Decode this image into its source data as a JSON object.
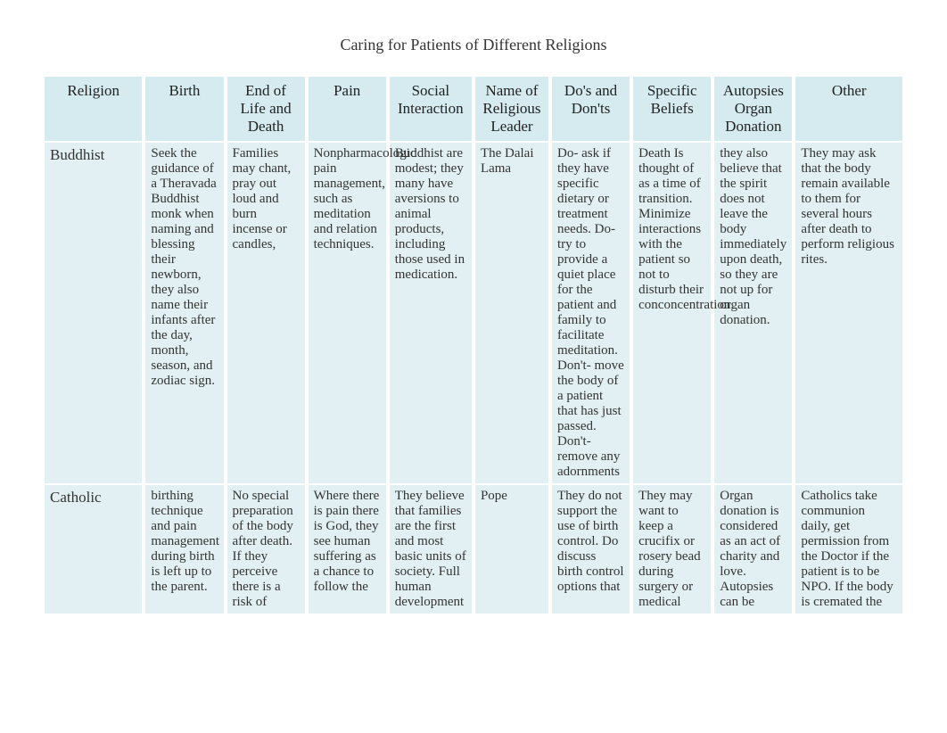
{
  "title": "Caring for Patients of Different Religions",
  "columns": [
    "Religion",
    "Birth",
    "End of Life and Death",
    "Pain",
    "Social Interaction",
    "Name of Religious Leader",
    "Do's and Don'ts",
    "Specific Beliefs",
    "Autopsies Organ Donation",
    "Other"
  ],
  "rows": [
    {
      "religion": "Buddhist",
      "birth": "Seek the guidance of a Theravada Buddhist monk when naming and blessing their newborn, they also name their infants after the day, month, season, and zodiac sign.",
      "endlife": "Families may chant, pray out loud and burn incense or candles,",
      "pain": "Nonpharmacologic pain management, such as meditation and relation techniques.",
      "social": "Buddhist are modest; they many have aversions to animal products, including those used in medication.",
      "leader": "The Dalai Lama",
      "dos": "Do- ask if they have specific dietary or treatment needs. Do- try to provide a quiet place for the patient and family to facilitate meditation. Don't- move the body of a patient that has just passed. Don't- remove any adornments",
      "beliefs": "Death Is thought of as a time of transition. Minimize interactions with the patient so not to disturb their conconcentration.",
      "autopsy": "they also believe that the spirit does not leave the body immediately upon death, so they are not up for organ donation.",
      "other": "They may ask that the body remain available to them for several hours after death to perform religious rites."
    },
    {
      "religion": "Catholic",
      "birth": "birthing technique and pain management during birth is left up to the parent.",
      "endlife": "No special preparation of the body after death. If they perceive there is a risk of",
      "pain": "Where there is pain there is God, they see human suffering as a chance to follow the",
      "social": "They believe that families are the first and most basic units of society. Full human development",
      "leader": "Pope",
      "dos": "They do not support the use of birth control. Do discuss birth control options that",
      "beliefs": "They may want to keep a crucifix or rosery bead during surgery or medical",
      "autopsy": "Organ donation is considered as an act of charity and love. Autopsies can be",
      "other": "Catholics take communion daily, get permission from the Doctor if the patient is to be NPO. If the body is cremated the"
    }
  ]
}
